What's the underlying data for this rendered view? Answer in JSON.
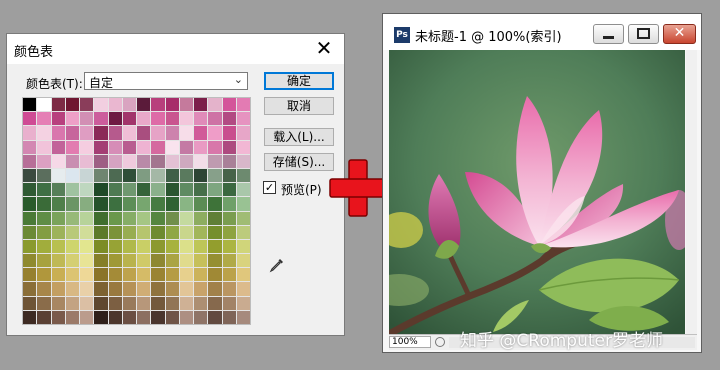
{
  "dialog": {
    "title": "颜色表",
    "close_glyph": "✕",
    "table_label": "颜色表(T):",
    "table_value": "自定",
    "buttons": {
      "ok": "确定",
      "cancel": "取消",
      "load": "载入(L)...",
      "save": "存储(S)..."
    },
    "preview_label": "预览(P)",
    "preview_checked": true,
    "swatches": [
      "#000000",
      "#ffffff",
      "#7d2a44",
      "#6f1631",
      "#8a3d5a",
      "#f2cfe0",
      "#eab7d0",
      "#d9a4c0",
      "#5b1b3a",
      "#b83f7c",
      "#a72c6a",
      "#c57a9c",
      "#7c1f4a",
      "#e4b3cb",
      "#d4559a",
      "#e37bb3",
      "#cf4b94",
      "#e57fb5",
      "#b8407e",
      "#ee9fc7",
      "#d28fb4",
      "#cc5d9c",
      "#6e1a43",
      "#a2356b",
      "#e9a9c9",
      "#de6ba7",
      "#c9558f",
      "#f3c6db",
      "#e08bb9",
      "#ce72a5",
      "#b24a83",
      "#e693c0",
      "#e9b0cd",
      "#f4d2e2",
      "#d976ad",
      "#c7659c",
      "#df9dc2",
      "#8b2a58",
      "#b65a8d",
      "#f0bed6",
      "#a94e7f",
      "#e6a3c6",
      "#cd83ad",
      "#f7dde9",
      "#d15a99",
      "#ef9dc8",
      "#c94d8e",
      "#e7a6c8",
      "#d387b2",
      "#f1c3da",
      "#c26399",
      "#e27cb0",
      "#f5cde0",
      "#a43e74",
      "#d68db7",
      "#b85d90",
      "#eeb3d2",
      "#d5699f",
      "#f9e3ee",
      "#c47aa4",
      "#e99ac3",
      "#d877aa",
      "#ad4a7f",
      "#f2b7d4",
      "#b76f98",
      "#dca0c2",
      "#f6d8e7",
      "#c98eb1",
      "#e8bcd4",
      "#9e5f84",
      "#d6a3c1",
      "#efcadd",
      "#b98aa8",
      "#a3758f",
      "#e3c1d4",
      "#cfa9bf",
      "#f2dde8",
      "#bf9bb0",
      "#a98098",
      "#d8b7ca",
      "#3b4a3f",
      "#5b6e5d",
      "#e6ecee",
      "#dbe6ef",
      "#c8d5d5",
      "#6f8570",
      "#4d6a52",
      "#2f4e38",
      "#7f9c82",
      "#a4b8a6",
      "#3f5f47",
      "#5a7a5e",
      "#2d4434",
      "#87a08a",
      "#476349",
      "#6d8a6f",
      "#2f5a33",
      "#3f6f44",
      "#567f58",
      "#9fc2a0",
      "#bed7bf",
      "#1f4a28",
      "#4e7a52",
      "#6f9870",
      "#35633a",
      "#8ab08b",
      "#2a5530",
      "#5f8b62",
      "#466f49",
      "#7ea680",
      "#3b6840",
      "#a9c7aa",
      "#2a5b2b",
      "#3a6b38",
      "#4f7f4a",
      "#6b9565",
      "#87ad80",
      "#25522b",
      "#3d7040",
      "#5c8e57",
      "#77a66f",
      "#467b42",
      "#2f6232",
      "#89b584",
      "#5b8c54",
      "#3e7339",
      "#6fa069",
      "#99c293",
      "#4a7a36",
      "#5f8d45",
      "#7aa35a",
      "#97b978",
      "#b7d39a",
      "#3f6e2e",
      "#6a984b",
      "#86ad66",
      "#a5c684",
      "#558640",
      "#708f4b",
      "#c4da9f",
      "#8dad60",
      "#5f7f36",
      "#7a9d4f",
      "#a0bc74",
      "#6c8a34",
      "#839d42",
      "#9db35a",
      "#b8c978",
      "#d1dd99",
      "#5c7a2a",
      "#7b9338",
      "#98ad51",
      "#b6c56e",
      "#6e8b30",
      "#8fa744",
      "#c9d68c",
      "#a2b65a",
      "#758f2c",
      "#8ea340",
      "#bccb7c",
      "#8a9a2e",
      "#a1ad3c",
      "#b8c050",
      "#ced56d",
      "#e2e68f",
      "#7c8c25",
      "#97a335",
      "#b0b94a",
      "#c9cf66",
      "#8c9930",
      "#a7b23e",
      "#dbe08a",
      "#bec658",
      "#939e2d",
      "#acb541",
      "#d0d57a",
      "#8f8a2f",
      "#a7a23f",
      "#bfb955",
      "#d4cf72",
      "#e8e496",
      "#857f28",
      "#9f9936",
      "#b9b34d",
      "#d0ca68",
      "#8e8832",
      "#aaa443",
      "#e0db8d",
      "#c6c05a",
      "#958f32",
      "#b0aa47",
      "#d9d37e",
      "#96802f",
      "#b0973c",
      "#c9af53",
      "#dcc472",
      "#eed897",
      "#8a7429",
      "#a48b37",
      "#bea34c",
      "#d5bb67",
      "#9a8433",
      "#b59c44",
      "#e7d08d",
      "#ccb35b",
      "#a08935",
      "#bba249",
      "#e0c77c",
      "#8a6e38",
      "#a7864a",
      "#c39f61",
      "#d8b883",
      "#e9d0a8",
      "#7d6231",
      "#99793f",
      "#b69257",
      "#d0ad75",
      "#8f733d",
      "#ad8d51",
      "#e2c597",
      "#c8a36a",
      "#a1814a",
      "#ba9662",
      "#dcbb8c",
      "#6e5436",
      "#8a6c4a",
      "#a88762",
      "#c3a382",
      "#dbbfa4",
      "#5f472f",
      "#7c5f42",
      "#997a5b",
      "#b7977a",
      "#73593c",
      "#917556",
      "#cfb195",
      "#ad8f72",
      "#86694d",
      "#a28367",
      "#c9ab90",
      "#3d2a22",
      "#5a4034",
      "#7a5a4b",
      "#9b7a69",
      "#bb9c8d",
      "#2f201a",
      "#4c362c",
      "#6b4f43",
      "#8c6f61",
      "#4a352d",
      "#6f5447",
      "#ad8f82",
      "#8f7467",
      "#624a40",
      "#7f6558",
      "#a68a7d"
    ]
  },
  "document": {
    "icon_label": "Ps",
    "title": "未标题-1 @ 100%(索引)",
    "close_glyph": "✕",
    "zoom": "100%"
  },
  "watermark": "知乎 @CRomputer罗老师",
  "colors": {
    "plus": "#e8141c",
    "photo_bg": "#4f7d58"
  }
}
